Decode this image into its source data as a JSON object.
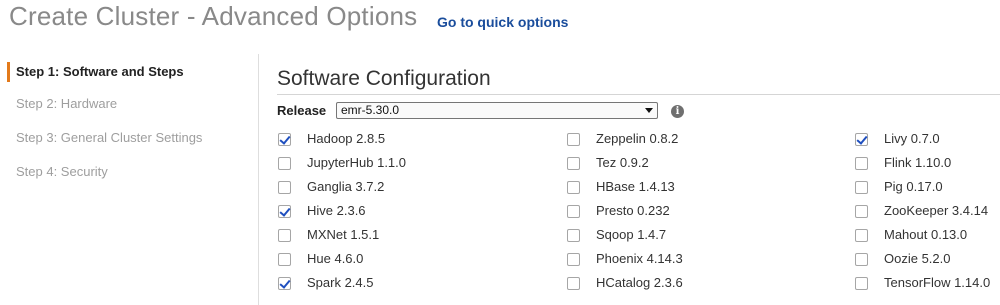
{
  "header": {
    "title": "Create Cluster - Advanced Options",
    "quick_link": "Go to quick options"
  },
  "steps": [
    {
      "label": "Step 1: Software and Steps",
      "active": true
    },
    {
      "label": "Step 2: Hardware",
      "active": false
    },
    {
      "label": "Step 3: General Cluster Settings",
      "active": false
    },
    {
      "label": "Step 4: Security",
      "active": false
    }
  ],
  "software": {
    "title": "Software Configuration",
    "release_label": "Release",
    "release_value": "emr-5.30.0",
    "info_icon": "info-icon",
    "columns": [
      [
        {
          "label": "Hadoop 2.8.5",
          "checked": true
        },
        {
          "label": "JupyterHub 1.1.0",
          "checked": false
        },
        {
          "label": "Ganglia 3.7.2",
          "checked": false
        },
        {
          "label": "Hive 2.3.6",
          "checked": true
        },
        {
          "label": "MXNet 1.5.1",
          "checked": false
        },
        {
          "label": "Hue 4.6.0",
          "checked": false
        },
        {
          "label": "Spark 2.4.5",
          "checked": true
        }
      ],
      [
        {
          "label": "Zeppelin 0.8.2",
          "checked": false
        },
        {
          "label": "Tez 0.9.2",
          "checked": false
        },
        {
          "label": "HBase 1.4.13",
          "checked": false
        },
        {
          "label": "Presto 0.232",
          "checked": false
        },
        {
          "label": "Sqoop 1.4.7",
          "checked": false
        },
        {
          "label": "Phoenix 4.14.3",
          "checked": false
        },
        {
          "label": "HCatalog 2.3.6",
          "checked": false
        }
      ],
      [
        {
          "label": "Livy 0.7.0",
          "checked": true
        },
        {
          "label": "Flink 1.10.0",
          "checked": false
        },
        {
          "label": "Pig 0.17.0",
          "checked": false
        },
        {
          "label": "ZooKeeper 3.4.14",
          "checked": false
        },
        {
          "label": "Mahout 0.13.0",
          "checked": false
        },
        {
          "label": "Oozie 5.2.0",
          "checked": false
        },
        {
          "label": "TensorFlow 1.14.0",
          "checked": false
        }
      ]
    ]
  },
  "colors": {
    "accent": "#e37a1b",
    "link": "#1a4d9c",
    "check": "#1f4fbf"
  }
}
